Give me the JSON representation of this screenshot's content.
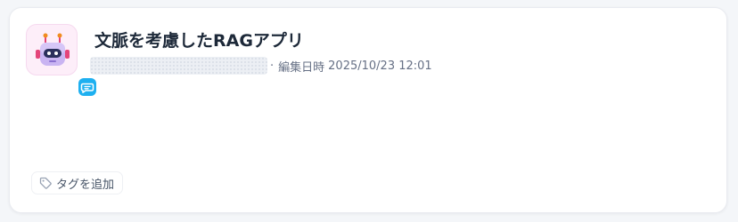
{
  "app_card": {
    "icon": {
      "name": "robot-icon",
      "background": "#fdeef9",
      "badge": {
        "name": "chatbot-mode-icon",
        "color": "#1eb0f0"
      }
    },
    "title": "文脈を考慮したRAGアプリ",
    "meta": {
      "separator": "·",
      "edited_label": "編集日時",
      "edited_at": "2025/10/23 12:01"
    },
    "tag_button": {
      "icon": "tag-icon",
      "label": "タグを追加"
    }
  }
}
